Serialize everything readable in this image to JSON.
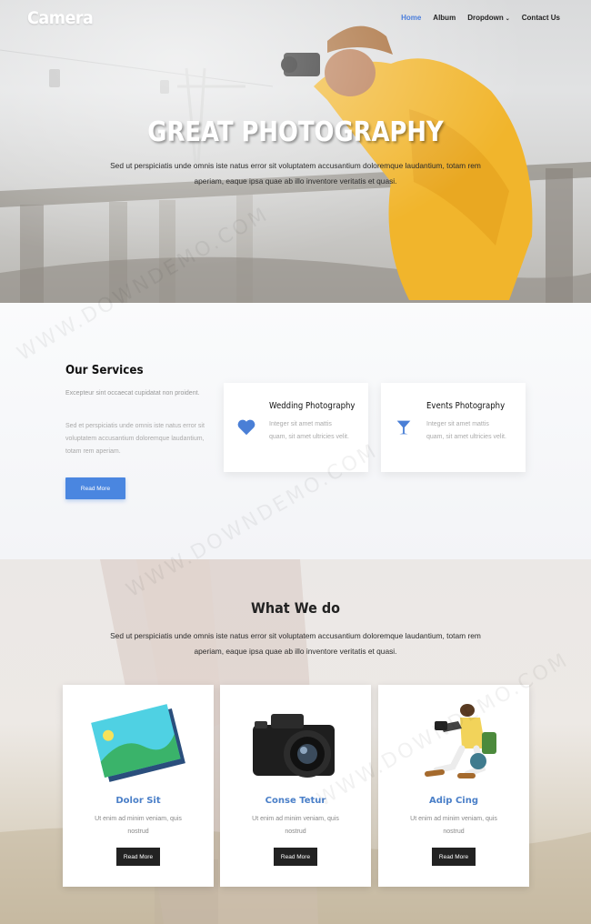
{
  "header": {
    "logo": "Camera",
    "nav": [
      "Home",
      "Album",
      "Dropdown",
      "Contact Us"
    ]
  },
  "hero": {
    "title": "GREAT PHOTOGRAPHY",
    "text": "Sed ut perspiciatis unde omnis iste natus error sit voluptatem accusantium doloremque laudantium, totam rem aperiam, eaque ipsa quae ab illo inventore veritatis et quasi."
  },
  "services": {
    "title": "Our Services",
    "text1": "Excepteur sint occaecat cupidatat non proident.",
    "text2": "Sed et perspiciatis unde omnis iste natus error sit voluptatem accusantium doloremque laudantium, totam rem aperiam.",
    "button": "Read More",
    "cards": [
      {
        "name": "Wedding Photography",
        "desc": "Integer sit amet mattis quam, sit amet ultricies velit.",
        "icon": "heart-icon"
      },
      {
        "name": "Events Photography",
        "desc": "Integer sit amet mattis quam, sit amet ultricies velit.",
        "icon": "cocktail-glass-icon"
      }
    ]
  },
  "whatwedo": {
    "title": "What We do",
    "text": "Sed ut perspiciatis unde omnis iste natus error sit voluptatem accusantium doloremque laudantium, totam rem aperiam, eaque ipsa quae ab illo inventore veritatis et quasi.",
    "cards": [
      {
        "title": "Dolor Sit",
        "text": "Ut enim ad minim veniam, quis nostrud",
        "button": "Read More"
      },
      {
        "title": "Conse Tetur",
        "text": "Ut enim ad minim veniam, quis nostrud",
        "button": "Read More"
      },
      {
        "title": "Adip Cing",
        "text": "Ut enim ad minim veniam, quis nostrud",
        "button": "Read More"
      }
    ]
  },
  "watermark": "WWW.DOWNDEMO.COM",
  "colors": {
    "accent": "#4a86e0",
    "nav_active": "#4a7ddc",
    "card_title": "#4a7fc8",
    "dark_button": "#222222"
  }
}
